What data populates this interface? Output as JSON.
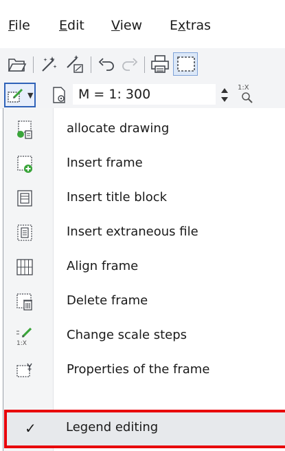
{
  "menubar": {
    "file": {
      "pre": "",
      "u": "F",
      "post": "ile"
    },
    "edit": {
      "pre": "",
      "u": "E",
      "post": "dit"
    },
    "view": {
      "pre": "",
      "u": "V",
      "post": "iew"
    },
    "extras": {
      "pre": "E",
      "u": "x",
      "post": "tras"
    }
  },
  "toolbar2": {
    "scale_value": "M = 1: 300",
    "scale_label": "1:X"
  },
  "menu": {
    "items": [
      {
        "label": "allocate drawing",
        "icon": "allocate-drawing-icon"
      },
      {
        "label": "Insert frame",
        "icon": "insert-frame-icon"
      },
      {
        "label": "Insert title block",
        "icon": "insert-title-block-icon"
      },
      {
        "label": "Insert extraneous file",
        "icon": "insert-file-icon"
      },
      {
        "label": "Align frame",
        "icon": "align-frame-icon"
      },
      {
        "label": "Delete frame",
        "icon": "delete-frame-icon"
      },
      {
        "label": "Change scale steps",
        "icon": "scale-steps-icon"
      },
      {
        "label": "Properties of the frame",
        "icon": "frame-properties-icon"
      }
    ],
    "legend": {
      "label": "Legend editing",
      "check": "✓"
    }
  },
  "colors": {
    "highlight": "#e8000a",
    "accent": "#2f62b8",
    "green": "#3aa53a"
  }
}
